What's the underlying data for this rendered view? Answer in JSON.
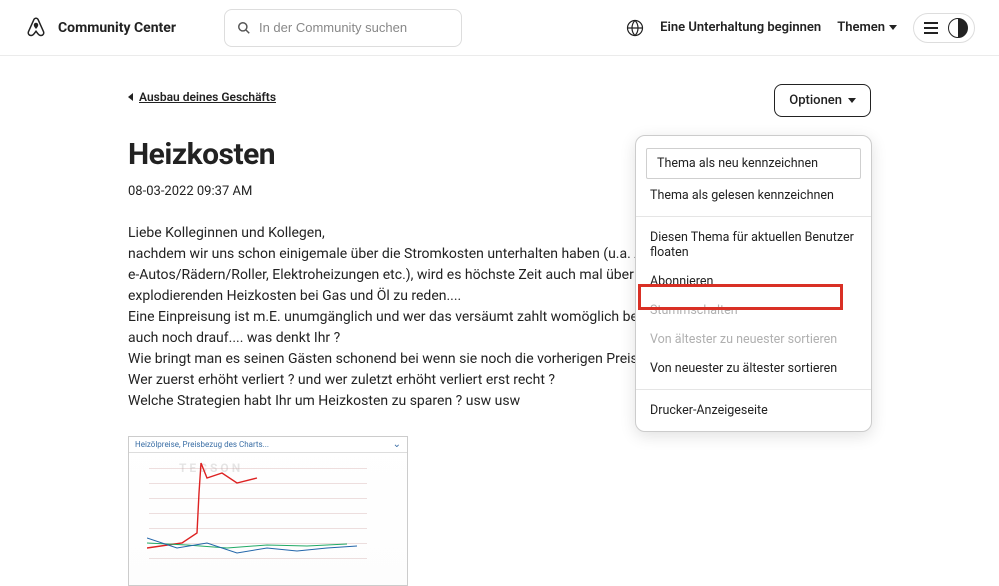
{
  "header": {
    "brand": "Community Center",
    "search_placeholder": "In der Community suchen",
    "start_conversation": "Eine Unterhaltung beginnen",
    "themes": "Themen"
  },
  "breadcrumb": {
    "label": "Ausbau deines Geschäfts"
  },
  "options": {
    "button": "Optionen"
  },
  "post": {
    "title": "Heizkosten",
    "date": "08-03-2022",
    "time": "09:37 AM",
    "p1": "Liebe Kolleginnen und Kollegen,",
    "p2": "nachdem wir uns schon einigemale über die Stromkosten unterhalten haben (u.a. Auflade",
    "p3": "e-Autos/Rädern/Roller, Elektroheizungen etc.), wird es höchste Zeit auch mal über die",
    "p4": "explodierenden Heizkosten bei Gas und Öl zu reden....",
    "p5": "Eine Einpreisung ist m.E. unumgänglich und wer das versäumt zahlt womöglich beim Ver",
    "p6": "auch noch drauf.... was denkt Ihr ?",
    "p7": "Wie bringt man es seinen Gästen schonend bei wenn sie noch die vorherigen Preise kenne",
    "p8": "Wer zuerst erhöht verliert ? und wer zuletzt erhöht verliert erst recht ?",
    "p9": "Welche Strategien habt Ihr um Heizkosten zu sparen ? usw usw"
  },
  "chart": {
    "header": "Heizölpreise, Preisbezug des Charts...",
    "watermark": "TECSON"
  },
  "menu": {
    "items": [
      "Thema als neu kennzeichnen",
      "Thema als gelesen kennzeichnen",
      "Diesen Thema für aktuellen Benutzer floaten",
      "Abonnieren",
      "Stummschalten",
      "Von ältester zu neuester sortieren",
      "Von neuester zu ältester sortieren",
      "Drucker-Anzeigeseite"
    ]
  }
}
